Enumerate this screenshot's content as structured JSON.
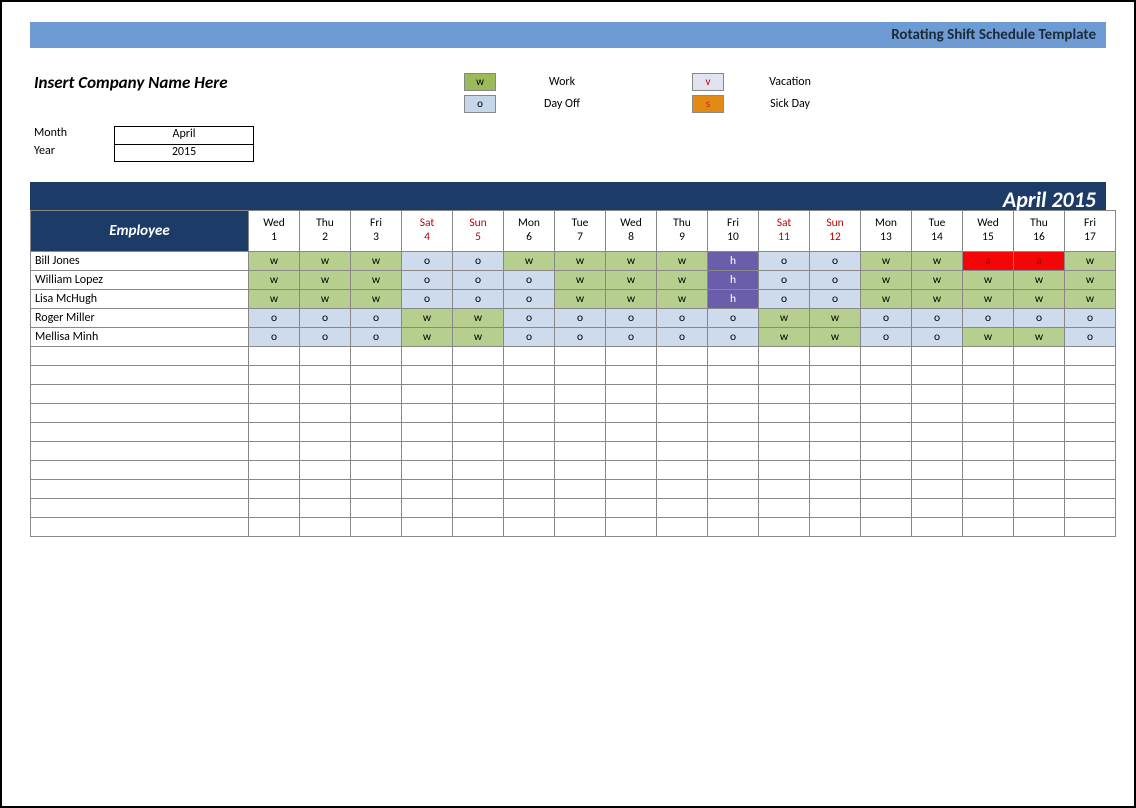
{
  "title": "Rotating Shift Schedule Template",
  "company_placeholder": "Insert Company Name Here",
  "selectors": {
    "month_label": "Month",
    "year_label": "Year",
    "month_value": "April",
    "year_value": "2015"
  },
  "legend": [
    {
      "code": "w",
      "label": "Work",
      "cls": "sw-w"
    },
    {
      "code": "o",
      "label": "Day Off",
      "cls": "sw-o"
    },
    {
      "code": "v",
      "label": "Vacation",
      "cls": "sw-v"
    },
    {
      "code": "s",
      "label": "Sick Day",
      "cls": "sw-s"
    }
  ],
  "month_title": "April 2015",
  "employee_header": "Employee",
  "days": [
    {
      "dow": "Wed",
      "num": "1",
      "wknd": false
    },
    {
      "dow": "Thu",
      "num": "2",
      "wknd": false
    },
    {
      "dow": "Fri",
      "num": "3",
      "wknd": false
    },
    {
      "dow": "Sat",
      "num": "4",
      "wknd": true
    },
    {
      "dow": "Sun",
      "num": "5",
      "wknd": true
    },
    {
      "dow": "Mon",
      "num": "6",
      "wknd": false
    },
    {
      "dow": "Tue",
      "num": "7",
      "wknd": false
    },
    {
      "dow": "Wed",
      "num": "8",
      "wknd": false
    },
    {
      "dow": "Thu",
      "num": "9",
      "wknd": false
    },
    {
      "dow": "Fri",
      "num": "10",
      "wknd": false
    },
    {
      "dow": "Sat",
      "num": "11",
      "wknd": true
    },
    {
      "dow": "Sun",
      "num": "12",
      "wknd": true
    },
    {
      "dow": "Mon",
      "num": "13",
      "wknd": false
    },
    {
      "dow": "Tue",
      "num": "14",
      "wknd": false
    },
    {
      "dow": "Wed",
      "num": "15",
      "wknd": false
    },
    {
      "dow": "Thu",
      "num": "16",
      "wknd": false
    },
    {
      "dow": "Fri",
      "num": "17",
      "wknd": false
    }
  ],
  "employees": [
    {
      "name": "Bill Jones",
      "codes": [
        "w",
        "w",
        "w",
        "o",
        "o",
        "w",
        "w",
        "w",
        "w",
        "h",
        "o",
        "o",
        "w",
        "w",
        "a",
        "a",
        "w"
      ]
    },
    {
      "name": "William Lopez",
      "codes": [
        "w",
        "w",
        "w",
        "o",
        "o",
        "o",
        "w",
        "w",
        "w",
        "h",
        "o",
        "o",
        "w",
        "w",
        "w",
        "w",
        "w"
      ]
    },
    {
      "name": "Lisa McHugh",
      "codes": [
        "w",
        "w",
        "w",
        "o",
        "o",
        "o",
        "w",
        "w",
        "w",
        "h",
        "o",
        "o",
        "w",
        "w",
        "w",
        "w",
        "w"
      ]
    },
    {
      "name": "Roger Miller",
      "codes": [
        "o",
        "o",
        "o",
        "w",
        "w",
        "o",
        "o",
        "o",
        "o",
        "o",
        "w",
        "w",
        "o",
        "o",
        "o",
        "o",
        "o"
      ]
    },
    {
      "name": "Mellisa Minh",
      "codes": [
        "o",
        "o",
        "o",
        "w",
        "w",
        "o",
        "o",
        "o",
        "o",
        "o",
        "w",
        "w",
        "o",
        "o",
        "w",
        "w",
        "o"
      ]
    }
  ],
  "blank_rows": 10
}
